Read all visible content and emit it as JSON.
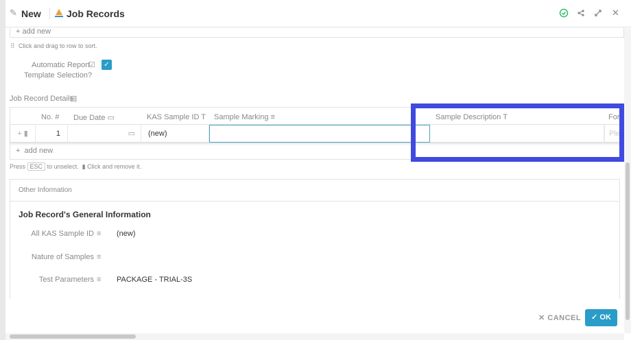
{
  "header": {
    "mode_label": "New",
    "title": "Job Records"
  },
  "top": {
    "add_new": "add new",
    "drag_hint": "Click and drag to row to sort."
  },
  "auto_report": {
    "label_line1": "Automatic Report",
    "label_line2": "Template Selection?",
    "checked": true
  },
  "details": {
    "title": "Job Record Details",
    "columns": [
      "No.",
      "Due Date",
      "KAS Sample ID",
      "Sample Marking",
      "Sample Description",
      "For"
    ],
    "row": {
      "no": "1",
      "due_date": "",
      "kas_sample_id": "(new)",
      "sample_marking": "",
      "sample_description": "",
      "for_placeholder": "Ple"
    },
    "add_new": "add new",
    "hint_press": "Press",
    "hint_key": "ESC",
    "hint_unselect": "to unselect.",
    "hint_remove": "Click and remove it."
  },
  "other": {
    "panel_title": "Other Information",
    "section_title": "Job Record's General Information",
    "fields": [
      {
        "label": "All KAS Sample ID",
        "value": "(new)"
      },
      {
        "label": "Nature of Samples",
        "value": ""
      },
      {
        "label": "Test Parameters",
        "value": "PACKAGE - TRIAL-3S"
      }
    ]
  },
  "footer": {
    "cancel": "CANCEL",
    "ok": "OK"
  },
  "colors": {
    "accent": "#2a9cc8",
    "highlight": "#4049e0",
    "success": "#2ebd6b"
  }
}
